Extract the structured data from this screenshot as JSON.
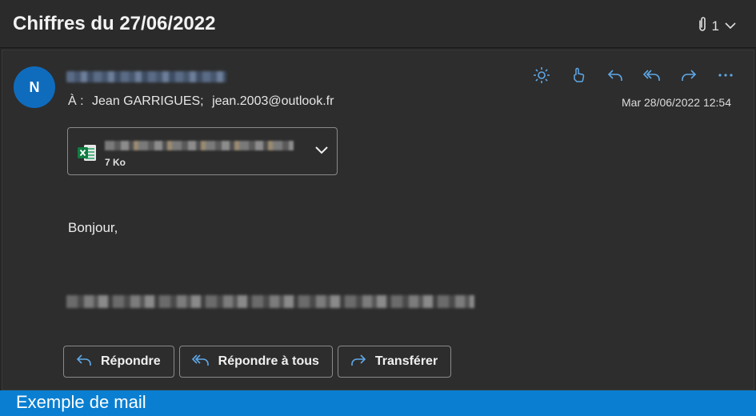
{
  "header": {
    "subject": "Chiffres du 27/06/2022",
    "attachment_count": "1",
    "icons": {
      "paperclip": "paperclip-icon",
      "chevron": "chevron-down-icon"
    }
  },
  "message": {
    "avatar_initial": "N",
    "to_prefix": "À :",
    "recipients": [
      "Jean GARRIGUES;",
      "jean.2003@outlook.fr"
    ],
    "date": "Mar 28/06/2022 12:54",
    "actions": [
      "sun-icon",
      "like-icon",
      "reply-icon",
      "reply-all-icon",
      "forward-icon",
      "more-icon"
    ],
    "attachment": {
      "size": "7 Ko",
      "icon": "excel-file-icon"
    },
    "greeting": "Bonjour,"
  },
  "reply_buttons": {
    "reply": "Répondre",
    "reply_all": "Répondre à tous",
    "forward": "Transférer"
  },
  "caption": "Exemple de mail",
  "colors": {
    "accent": "#0f6cbd",
    "caption_bg": "#0a7fd1",
    "action_icons": "#5ea8e8"
  }
}
